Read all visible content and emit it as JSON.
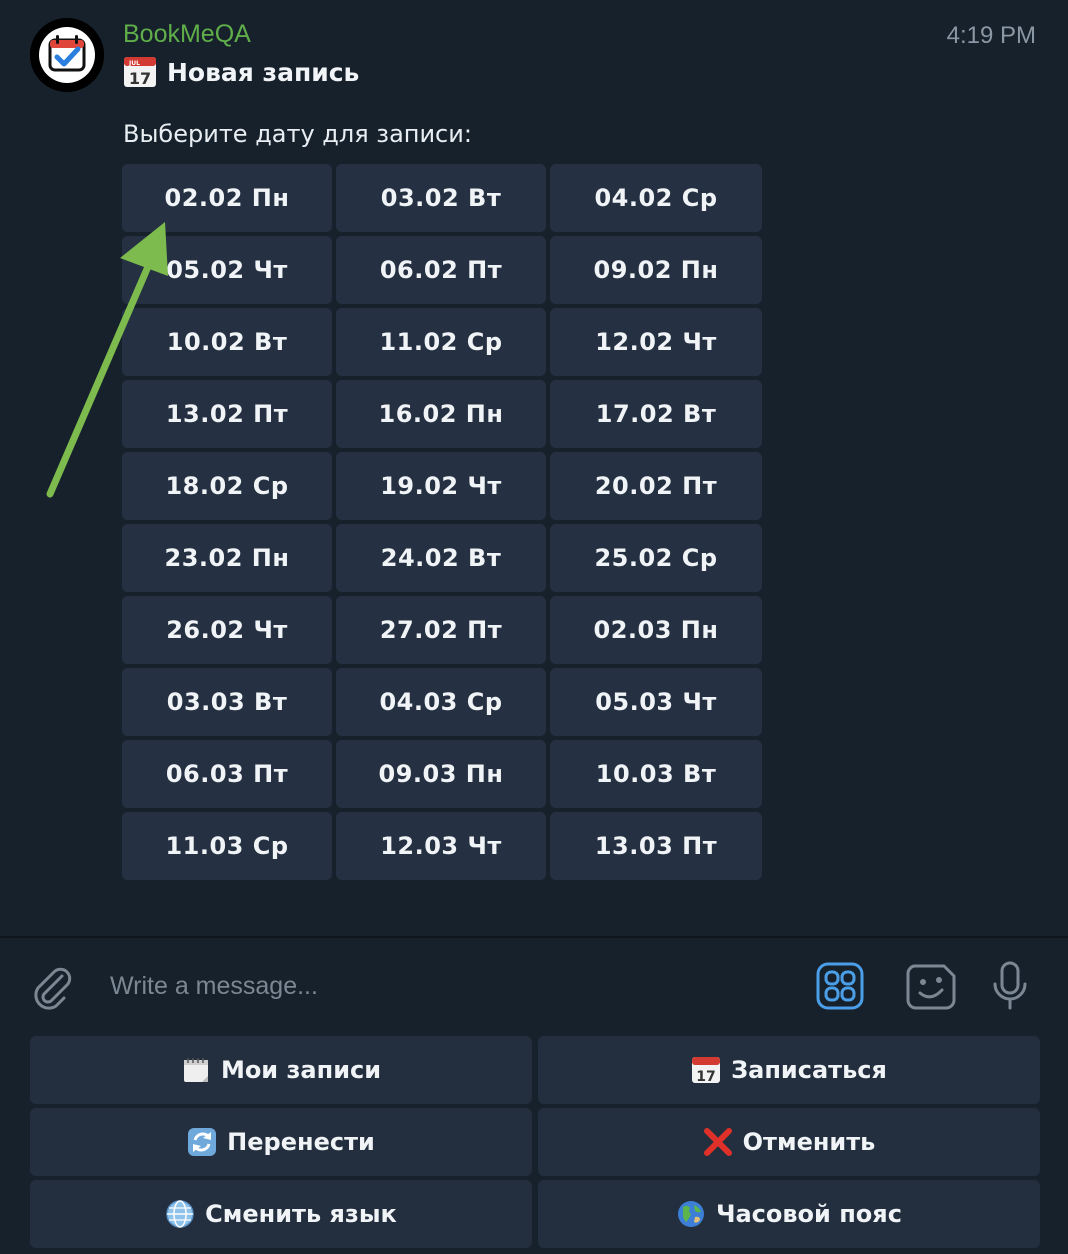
{
  "message": {
    "sender": "BookMeQA",
    "time": "4:19 PM",
    "title": "Новая запись",
    "body": "Выберите дату для записи:",
    "dates": [
      "02.02 Пн",
      "03.02 Вт",
      "04.02 Ср",
      "05.02 Чт",
      "06.02 Пт",
      "09.02 Пн",
      "10.02 Вт",
      "11.02 Ср",
      "12.02 Чт",
      "13.02 Пт",
      "16.02 Пн",
      "17.02 Вт",
      "18.02 Ср",
      "19.02 Чт",
      "20.02 Пт",
      "23.02 Пн",
      "24.02 Вт",
      "25.02 Ср",
      "26.02 Чт",
      "27.02 Пт",
      "02.03 Пн",
      "03.03 Вт",
      "04.03 Ср",
      "05.03 Чт",
      "06.03 Пт",
      "09.03 Пн",
      "10.03 Вт",
      "11.03 Ср",
      "12.03 Чт",
      "13.03 Пт"
    ],
    "calendar_icon_day": "17",
    "calendar_icon_month": "JUL"
  },
  "composer": {
    "placeholder": "Write a message..."
  },
  "keyboard": {
    "my_bookings": "Мои записи",
    "book": "Записаться",
    "reschedule": "Перенести",
    "cancel": "Отменить",
    "change_language": "Сменить язык",
    "timezone": "Часовой пояс"
  },
  "colors": {
    "accent_green": "#5fae4a",
    "annotation_arrow": "#7dbb4e",
    "button_bg": "#253142",
    "chat_bg": "#17212b"
  }
}
